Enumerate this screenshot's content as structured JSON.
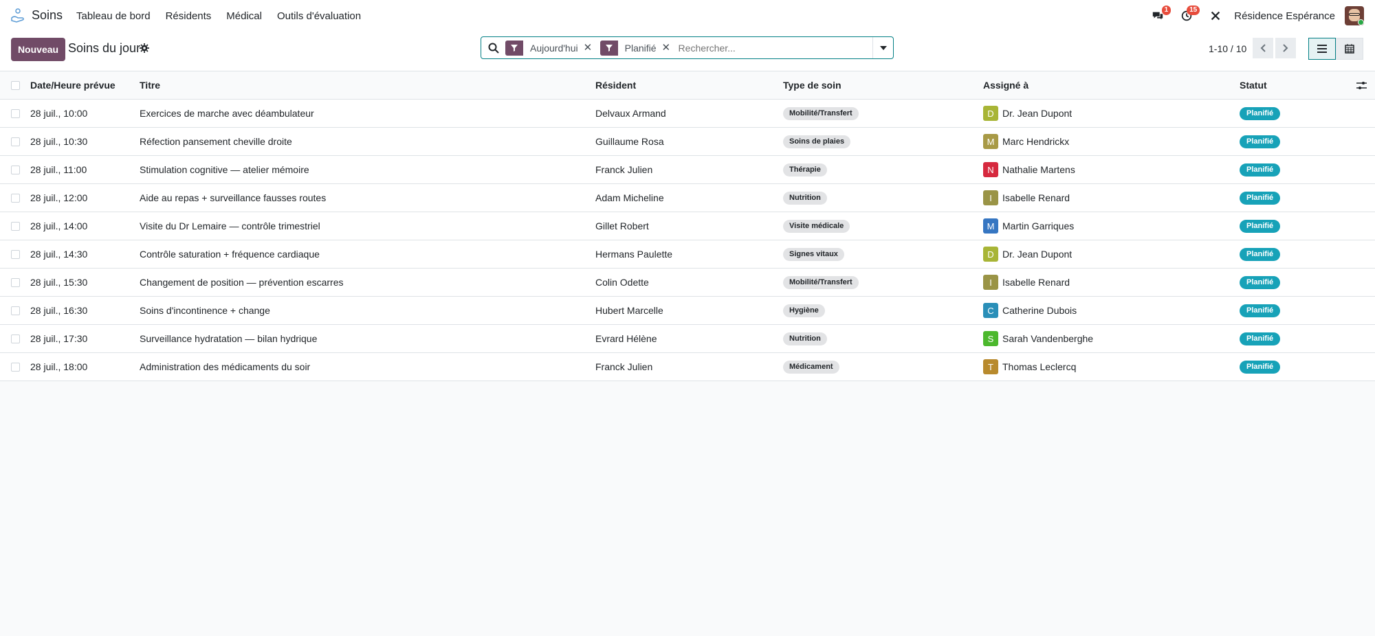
{
  "navbar": {
    "app_name": "Soins",
    "menu": [
      "Tableau de bord",
      "Résidents",
      "Médical",
      "Outils d'évaluation"
    ],
    "messages_count": "1",
    "activities_count": "15",
    "company": "Résidence Espérance"
  },
  "control": {
    "new_button": "Nouveau",
    "title": "Soins du jour",
    "facets": [
      "Aujourd'hui",
      "Planifié"
    ],
    "search_placeholder": "Rechercher...",
    "pager": "1-10 / 10"
  },
  "table": {
    "headers": [
      "Date/Heure prévue",
      "Titre",
      "Résident",
      "Type de soin",
      "Assigné à",
      "Statut"
    ],
    "rows": [
      {
        "date": "28 juil., 10:00",
        "title": "Exercices de marche avec déambulateur",
        "resident": "Delvaux Armand",
        "type": "Mobilité/Transfert",
        "initial": "D",
        "color": "#a8b536",
        "assignee": "Dr. Jean Dupont",
        "status": "Planifié"
      },
      {
        "date": "28 juil., 10:30",
        "title": "Réfection pansement cheville droite",
        "resident": "Guillaume Rosa",
        "type": "Soins de plaies",
        "initial": "M",
        "color": "#a89a46",
        "assignee": "Marc Hendrickx",
        "status": "Planifié"
      },
      {
        "date": "28 juil., 11:00",
        "title": "Stimulation cognitive — atelier mémoire",
        "resident": "Franck Julien",
        "type": "Thérapie",
        "initial": "N",
        "color": "#d6293e",
        "assignee": "Nathalie Martens",
        "status": "Planifié"
      },
      {
        "date": "28 juil., 12:00",
        "title": "Aide au repas + surveillance fausses routes",
        "resident": "Adam Micheline",
        "type": "Nutrition",
        "initial": "I",
        "color": "#9a9446",
        "assignee": "Isabelle Renard",
        "status": "Planifié"
      },
      {
        "date": "28 juil., 14:00",
        "title": "Visite du Dr Lemaire — contrôle trimestriel",
        "resident": "Gillet Robert",
        "type": "Visite médicale",
        "initial": "M",
        "color": "#3676c2",
        "assignee": "Martin Garriques",
        "status": "Planifié"
      },
      {
        "date": "28 juil., 14:30",
        "title": "Contrôle saturation + fréquence cardiaque",
        "resident": "Hermans Paulette",
        "type": "Signes vitaux",
        "initial": "D",
        "color": "#a8b536",
        "assignee": "Dr. Jean Dupont",
        "status": "Planifié"
      },
      {
        "date": "28 juil., 15:30",
        "title": "Changement de position — prévention escarres",
        "resident": "Colin Odette",
        "type": "Mobilité/Transfert",
        "initial": "I",
        "color": "#9a9446",
        "assignee": "Isabelle Renard",
        "status": "Planifié"
      },
      {
        "date": "28 juil., 16:30",
        "title": "Soins d'incontinence + change",
        "resident": "Hubert Marcelle",
        "type": "Hygiène",
        "initial": "C",
        "color": "#2a8fb8",
        "assignee": "Catherine Dubois",
        "status": "Planifié"
      },
      {
        "date": "28 juil., 17:30",
        "title": "Surveillance hydratation — bilan hydrique",
        "resident": "Evrard Hélène",
        "type": "Nutrition",
        "initial": "S",
        "color": "#4cb82d",
        "assignee": "Sarah Vandenberghe",
        "status": "Planifié"
      },
      {
        "date": "28 juil., 18:00",
        "title": "Administration des médicaments du soir",
        "resident": "Franck Julien",
        "type": "Médicament",
        "initial": "T",
        "color": "#b88a2d",
        "assignee": "Thomas Leclercq",
        "status": "Planifié"
      }
    ]
  },
  "colors": {
    "brand": "#714b67",
    "accent": "#017e84",
    "status": "#17a2b8"
  }
}
